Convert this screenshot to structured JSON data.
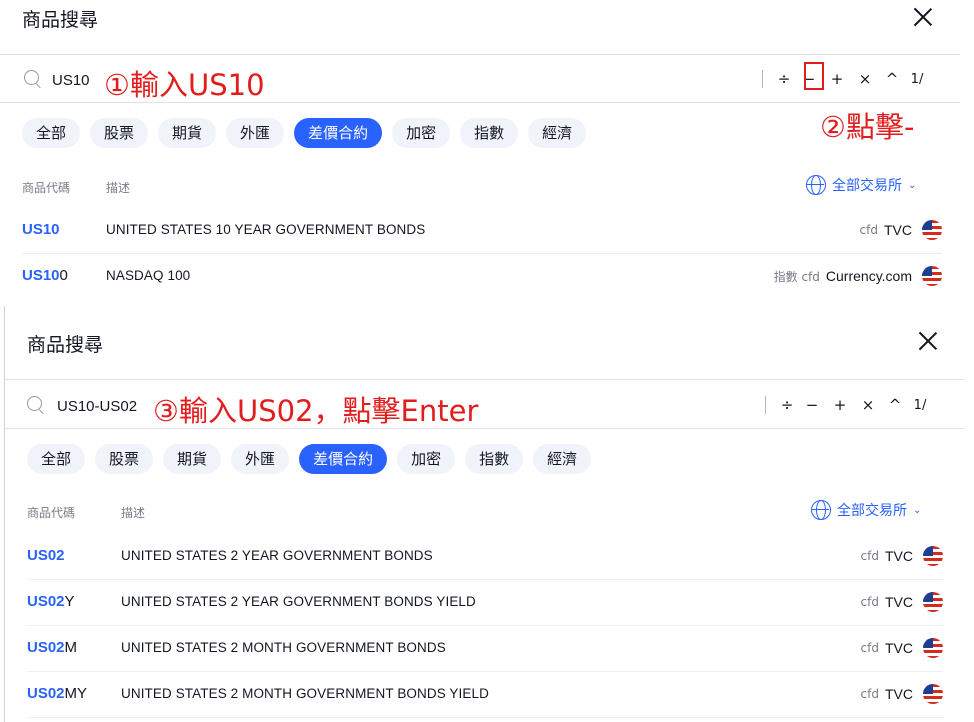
{
  "colors": {
    "accent": "#2962ff",
    "annotation": "#e11d1d"
  },
  "panel1": {
    "title": "商品搜尋",
    "query": "US10",
    "annotation_1": "①輸入US10",
    "ops": {
      "divide": "÷",
      "minus": "−",
      "plus": "+",
      "times": "×",
      "caret": "^",
      "slash": "1/"
    },
    "annotation_2": "②點擊-",
    "chips": [
      "全部",
      "股票",
      "期貨",
      "外匯",
      "差價合約",
      "加密",
      "指數",
      "經濟"
    ],
    "active_chip": "差價合約",
    "col_symbol": "商品代碼",
    "col_desc": "描述",
    "exchange_filter": "全部交易所",
    "rows": [
      {
        "sym_match": "US10",
        "sym_rest": "",
        "desc": "UNITED STATES 10 YEAR GOVERNMENT BONDS",
        "tags": "cfd",
        "source": "TVC"
      },
      {
        "sym_match": "US10",
        "sym_rest": "0",
        "desc": "NASDAQ 100",
        "tags": "指數 cfd",
        "source": "Currency.com"
      }
    ]
  },
  "panel2": {
    "title": "商品搜尋",
    "query": "US10-US02",
    "annotation_3": "③輸入US02，點擊Enter",
    "ops": {
      "divide": "÷",
      "minus": "−",
      "plus": "+",
      "times": "×",
      "caret": "^",
      "slash": "1/"
    },
    "chips": [
      "全部",
      "股票",
      "期貨",
      "外匯",
      "差價合約",
      "加密",
      "指數",
      "經濟"
    ],
    "active_chip": "差價合約",
    "col_symbol": "商品代碼",
    "col_desc": "描述",
    "exchange_filter": "全部交易所",
    "rows": [
      {
        "sym_match": "US02",
        "sym_rest": "",
        "desc": "UNITED STATES 2 YEAR GOVERNMENT BONDS",
        "tags": "cfd",
        "source": "TVC"
      },
      {
        "sym_match": "US02",
        "sym_rest": "Y",
        "desc": "UNITED STATES 2 YEAR GOVERNMENT BONDS YIELD",
        "tags": "cfd",
        "source": "TVC"
      },
      {
        "sym_match": "US02",
        "sym_rest": "M",
        "desc": "UNITED STATES 2 MONTH GOVERNMENT BONDS",
        "tags": "cfd",
        "source": "TVC"
      },
      {
        "sym_match": "US02",
        "sym_rest": "MY",
        "desc": "UNITED STATES 2 MONTH GOVERNMENT BONDS YIELD",
        "tags": "cfd",
        "source": "TVC"
      }
    ]
  },
  "icons": {
    "search": "search-icon",
    "close": "close-icon",
    "globe": "globe-icon",
    "flag": "us-flag-icon",
    "chevron": "chevron-down-icon"
  }
}
